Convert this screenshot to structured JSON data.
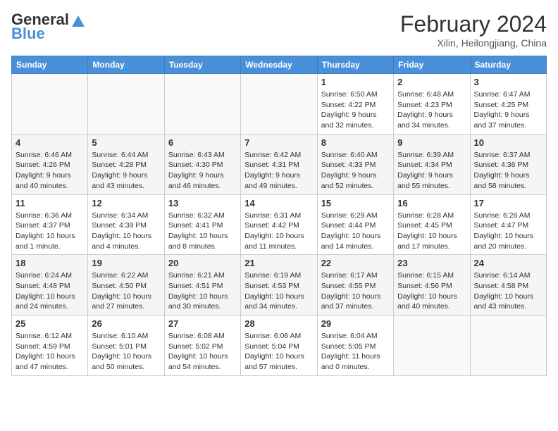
{
  "header": {
    "logo_line1": "General",
    "logo_line2": "Blue",
    "month_title": "February 2024",
    "subtitle": "Xilin, Heilongjiang, China"
  },
  "days_of_week": [
    "Sunday",
    "Monday",
    "Tuesday",
    "Wednesday",
    "Thursday",
    "Friday",
    "Saturday"
  ],
  "weeks": [
    [
      {
        "day": "",
        "info": ""
      },
      {
        "day": "",
        "info": ""
      },
      {
        "day": "",
        "info": ""
      },
      {
        "day": "",
        "info": ""
      },
      {
        "day": "1",
        "info": "Sunrise: 6:50 AM\nSunset: 4:22 PM\nDaylight: 9 hours and 32 minutes."
      },
      {
        "day": "2",
        "info": "Sunrise: 6:48 AM\nSunset: 4:23 PM\nDaylight: 9 hours and 34 minutes."
      },
      {
        "day": "3",
        "info": "Sunrise: 6:47 AM\nSunset: 4:25 PM\nDaylight: 9 hours and 37 minutes."
      }
    ],
    [
      {
        "day": "4",
        "info": "Sunrise: 6:46 AM\nSunset: 4:26 PM\nDaylight: 9 hours and 40 minutes."
      },
      {
        "day": "5",
        "info": "Sunrise: 6:44 AM\nSunset: 4:28 PM\nDaylight: 9 hours and 43 minutes."
      },
      {
        "day": "6",
        "info": "Sunrise: 6:43 AM\nSunset: 4:30 PM\nDaylight: 9 hours and 46 minutes."
      },
      {
        "day": "7",
        "info": "Sunrise: 6:42 AM\nSunset: 4:31 PM\nDaylight: 9 hours and 49 minutes."
      },
      {
        "day": "8",
        "info": "Sunrise: 6:40 AM\nSunset: 4:33 PM\nDaylight: 9 hours and 52 minutes."
      },
      {
        "day": "9",
        "info": "Sunrise: 6:39 AM\nSunset: 4:34 PM\nDaylight: 9 hours and 55 minutes."
      },
      {
        "day": "10",
        "info": "Sunrise: 6:37 AM\nSunset: 4:36 PM\nDaylight: 9 hours and 58 minutes."
      }
    ],
    [
      {
        "day": "11",
        "info": "Sunrise: 6:36 AM\nSunset: 4:37 PM\nDaylight: 10 hours and 1 minute."
      },
      {
        "day": "12",
        "info": "Sunrise: 6:34 AM\nSunset: 4:39 PM\nDaylight: 10 hours and 4 minutes."
      },
      {
        "day": "13",
        "info": "Sunrise: 6:32 AM\nSunset: 4:41 PM\nDaylight: 10 hours and 8 minutes."
      },
      {
        "day": "14",
        "info": "Sunrise: 6:31 AM\nSunset: 4:42 PM\nDaylight: 10 hours and 11 minutes."
      },
      {
        "day": "15",
        "info": "Sunrise: 6:29 AM\nSunset: 4:44 PM\nDaylight: 10 hours and 14 minutes."
      },
      {
        "day": "16",
        "info": "Sunrise: 6:28 AM\nSunset: 4:45 PM\nDaylight: 10 hours and 17 minutes."
      },
      {
        "day": "17",
        "info": "Sunrise: 6:26 AM\nSunset: 4:47 PM\nDaylight: 10 hours and 20 minutes."
      }
    ],
    [
      {
        "day": "18",
        "info": "Sunrise: 6:24 AM\nSunset: 4:48 PM\nDaylight: 10 hours and 24 minutes."
      },
      {
        "day": "19",
        "info": "Sunrise: 6:22 AM\nSunset: 4:50 PM\nDaylight: 10 hours and 27 minutes."
      },
      {
        "day": "20",
        "info": "Sunrise: 6:21 AM\nSunset: 4:51 PM\nDaylight: 10 hours and 30 minutes."
      },
      {
        "day": "21",
        "info": "Sunrise: 6:19 AM\nSunset: 4:53 PM\nDaylight: 10 hours and 34 minutes."
      },
      {
        "day": "22",
        "info": "Sunrise: 6:17 AM\nSunset: 4:55 PM\nDaylight: 10 hours and 37 minutes."
      },
      {
        "day": "23",
        "info": "Sunrise: 6:15 AM\nSunset: 4:56 PM\nDaylight: 10 hours and 40 minutes."
      },
      {
        "day": "24",
        "info": "Sunrise: 6:14 AM\nSunset: 4:58 PM\nDaylight: 10 hours and 43 minutes."
      }
    ],
    [
      {
        "day": "25",
        "info": "Sunrise: 6:12 AM\nSunset: 4:59 PM\nDaylight: 10 hours and 47 minutes."
      },
      {
        "day": "26",
        "info": "Sunrise: 6:10 AM\nSunset: 5:01 PM\nDaylight: 10 hours and 50 minutes."
      },
      {
        "day": "27",
        "info": "Sunrise: 6:08 AM\nSunset: 5:02 PM\nDaylight: 10 hours and 54 minutes."
      },
      {
        "day": "28",
        "info": "Sunrise: 6:06 AM\nSunset: 5:04 PM\nDaylight: 10 hours and 57 minutes."
      },
      {
        "day": "29",
        "info": "Sunrise: 6:04 AM\nSunset: 5:05 PM\nDaylight: 11 hours and 0 minutes."
      },
      {
        "day": "",
        "info": ""
      },
      {
        "day": "",
        "info": ""
      }
    ]
  ]
}
